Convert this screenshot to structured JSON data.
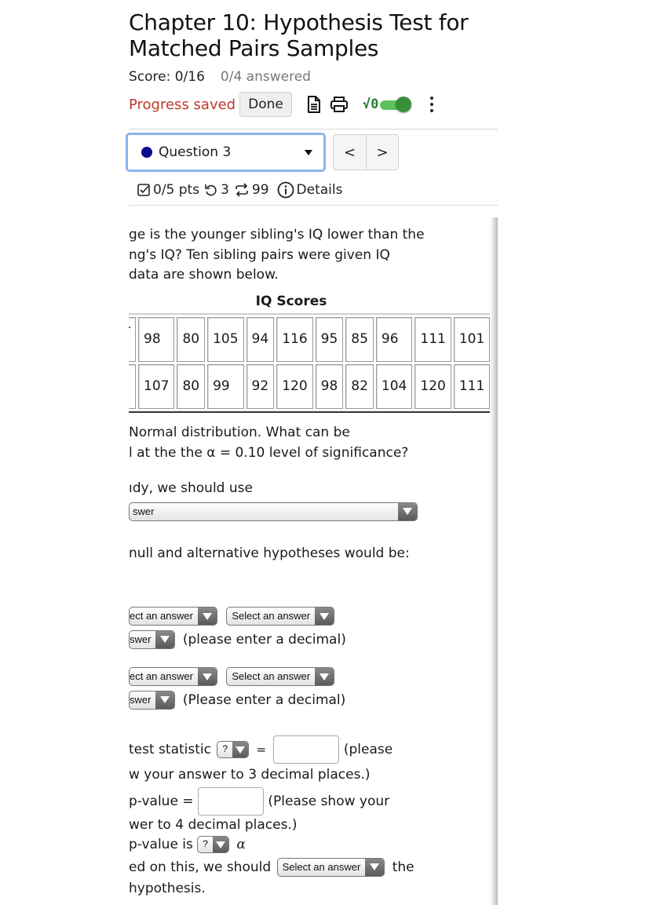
{
  "header": {
    "title_line1": "Chapter 10: Hypothesis Test for",
    "title_line2": "Matched Pairs Samples",
    "score": "Score: 0/16",
    "answered": "0/4 answered",
    "progress_status": "Progress saved",
    "done_label": "Done",
    "icons": [
      "document-icon",
      "print-icon",
      "math-toggle-icon",
      "more-icon"
    ],
    "math_toggle_label": "√0",
    "math_toggle_on": true
  },
  "question_nav": {
    "selected": "Question 3",
    "status_color": "#0b0b8f",
    "prev_label": "<",
    "next_label": ">"
  },
  "question_meta": {
    "points": "0/5 pts",
    "retries": "3",
    "attempts": "99",
    "details_label": "Details"
  },
  "question": {
    "intro_lines": [
      "ge is the younger sibling's IQ lower than the",
      "ng's IQ? Ten sibling pairs were given IQ",
      " data are shown below."
    ],
    "table_title": "IQ Scores",
    "table": {
      "row_headers": [
        "r",
        ""
      ],
      "rows": [
        [
          "98",
          "80",
          "105",
          "94",
          "116",
          "95",
          "85",
          "96",
          "111",
          "101"
        ],
        [
          "107",
          "80",
          "99",
          "92",
          "120",
          "98",
          "82",
          "104",
          "120",
          "111"
        ]
      ]
    },
    "after_table_lines": [
      " Normal distribution.  What can be",
      "l at the the α = 0.10 level of significance?"
    ],
    "study_prompt": "ıdy, we should use",
    "study_select": "swer",
    "hyp_prompt": " null and alternative hypotheses would be:",
    "h0": {
      "sel1": "ect an answer",
      "sel2": "Select an answer",
      "sel3": "swer",
      "hint": "(please enter a decimal)"
    },
    "h1": {
      "sel1": "ect an answer",
      "sel2": "Select an answer",
      "sel3": "swer",
      "hint": "(Please enter a decimal)"
    },
    "test_stat_label": " test statistic",
    "test_stat_select": "?",
    "equals": "=",
    "test_stat_value": "",
    "test_stat_hint_a": "(please",
    "test_stat_hint_b": "w your answer to 3 decimal places.)",
    "pvalue_label": " p-value =",
    "pvalue_value": "",
    "pvalue_hint_a": "(Please show your",
    "pvalue_hint_b": "wer to 4 decimal places.)",
    "pcompare_label": " p-value is",
    "pcompare_select": "?",
    "alpha": "α",
    "decision_label": "ed on this, we should",
    "decision_select": "Select an answer",
    "decision_after": "the",
    "decision_end": " hypothesis."
  }
}
